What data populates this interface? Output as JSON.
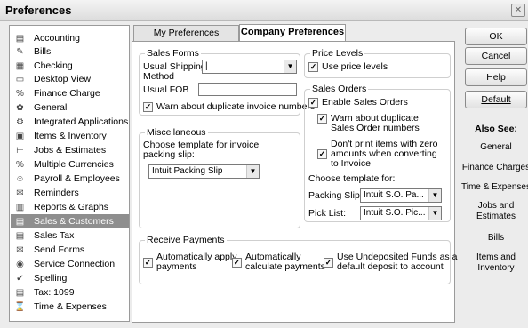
{
  "window": {
    "title": "Preferences",
    "close_glyph": "✕"
  },
  "sidebar": {
    "items": [
      {
        "label": "Accounting",
        "icon": "ledger-icon",
        "glyph": "▤"
      },
      {
        "label": "Bills",
        "icon": "bill-icon",
        "glyph": "✎"
      },
      {
        "label": "Checking",
        "icon": "checkbook-icon",
        "glyph": "▦"
      },
      {
        "label": "Desktop View",
        "icon": "desktop-icon",
        "glyph": "▭"
      },
      {
        "label": "Finance Charge",
        "icon": "percent-icon",
        "glyph": "%"
      },
      {
        "label": "General",
        "icon": "general-icon",
        "glyph": "✿"
      },
      {
        "label": "Integrated Applications",
        "icon": "apps-icon",
        "glyph": "⚙"
      },
      {
        "label": "Items & Inventory",
        "icon": "inventory-icon",
        "glyph": "▣"
      },
      {
        "label": "Jobs & Estimates",
        "icon": "jobs-icon",
        "glyph": "⊢"
      },
      {
        "label": "Multiple Currencies",
        "icon": "currency-icon",
        "glyph": "%"
      },
      {
        "label": "Payroll & Employees",
        "icon": "payroll-icon",
        "glyph": "☺"
      },
      {
        "label": "Reminders",
        "icon": "reminders-icon",
        "glyph": "✉"
      },
      {
        "label": "Reports & Graphs",
        "icon": "reports-icon",
        "glyph": "▥"
      },
      {
        "label": "Sales & Customers",
        "icon": "sales-icon",
        "glyph": "▤"
      },
      {
        "label": "Sales Tax",
        "icon": "sales-tax-icon",
        "glyph": "▤"
      },
      {
        "label": "Send Forms",
        "icon": "send-forms-icon",
        "glyph": "✉"
      },
      {
        "label": "Service Connection",
        "icon": "service-icon",
        "glyph": "◉"
      },
      {
        "label": "Spelling",
        "icon": "spelling-icon",
        "glyph": "✔"
      },
      {
        "label": "Tax: 1099",
        "icon": "tax-icon",
        "glyph": "▤"
      },
      {
        "label": "Time & Expenses",
        "icon": "time-icon",
        "glyph": "⌛"
      }
    ],
    "selected_index": 13
  },
  "tabs": {
    "my": "My Preferences",
    "company": "Company Preferences"
  },
  "sales_forms": {
    "title": "Sales Forms",
    "shipping_label_1": "Usual Shipping",
    "shipping_label_2": "Method",
    "shipping_value": "|",
    "fob_label": "Usual FOB",
    "fob_value": "",
    "warn_dup_invoice": "Warn about duplicate invoice numbers"
  },
  "misc": {
    "title": "Miscellaneous",
    "template_label_1": "Choose template for invoice",
    "template_label_2": "packing slip:",
    "template_value": "Intuit Packing Slip"
  },
  "price_levels": {
    "title": "Price Levels",
    "use_label": "Use price levels"
  },
  "sales_orders": {
    "title": "Sales Orders",
    "enable": "Enable Sales Orders",
    "warn_1": "Warn about duplicate",
    "warn_2": "Sales Order numbers",
    "noprint_1": "Don't print items with zero",
    "noprint_2": "amounts when converting",
    "noprint_3": "to Invoice",
    "choose_template": "Choose template for:",
    "packing_slip_label": "Packing Slip:",
    "packing_slip_value": "Intuit S.O. Pa...",
    "pick_list_label": "Pick List:",
    "pick_list_value": "Intuit S.O. Pic..."
  },
  "receive_payments": {
    "title": "Receive Payments",
    "auto_apply_1": "Automatically apply",
    "auto_apply_2": "payments",
    "auto_calc_1": "Automatically",
    "auto_calc_2": "calculate payments",
    "undeposited_1": "Use Undeposited Funds as a",
    "undeposited_2": "default deposit to account"
  },
  "buttons": {
    "ok": "OK",
    "cancel": "Cancel",
    "help": "Help",
    "default": "Default"
  },
  "also_see": {
    "title": "Also See:",
    "general": "General",
    "finance": "Finance Charges",
    "time": "Time & Expenses",
    "jobs_1": "Jobs and",
    "jobs_2": "Estimates",
    "bills": "Bills",
    "items_1": "Items and",
    "items_2": "Inventory"
  },
  "glyphs": {
    "check": "✓",
    "arrow": "▼"
  }
}
